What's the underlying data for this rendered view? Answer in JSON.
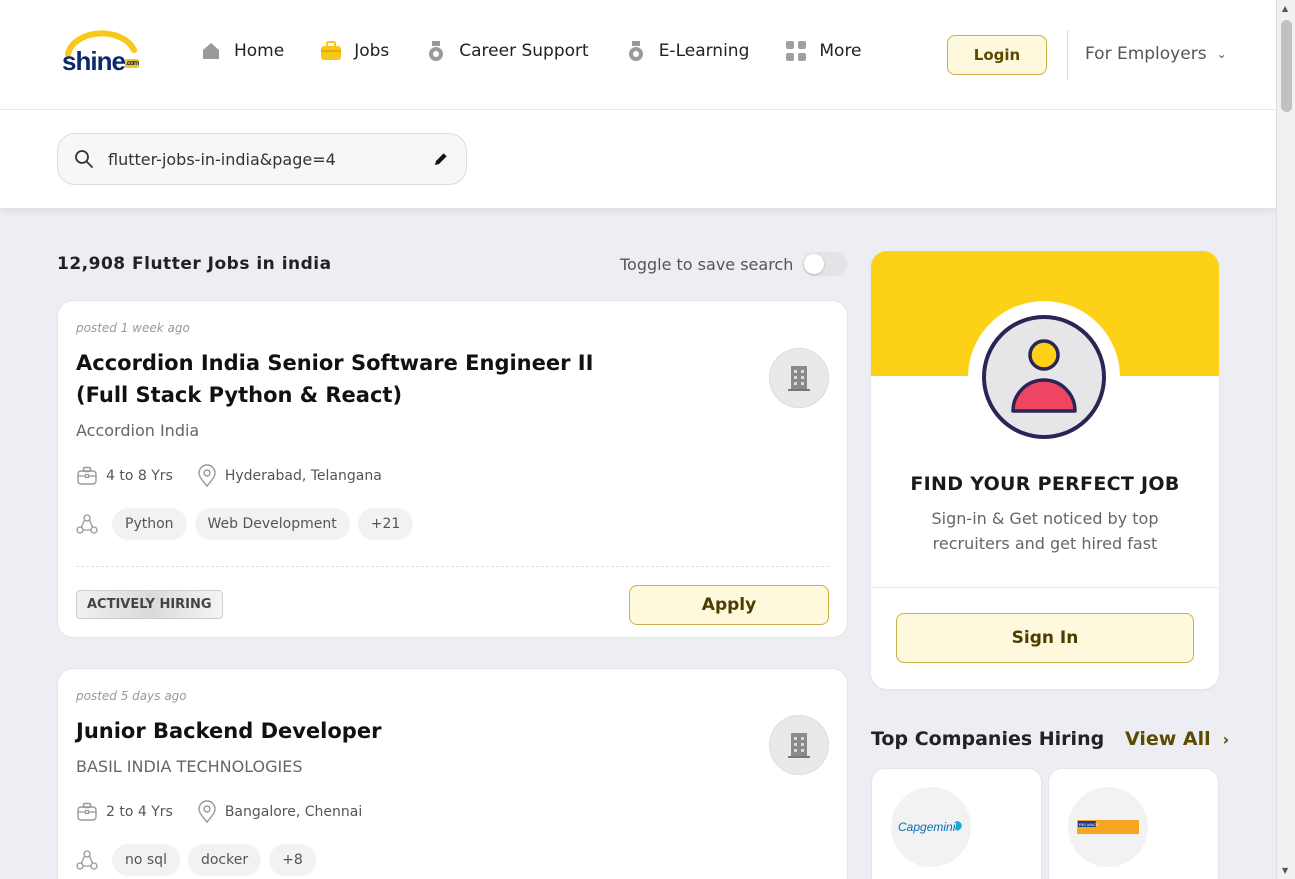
{
  "header": {
    "logo_text": "shine",
    "logo_com": ".com",
    "nav": [
      {
        "label": "Home",
        "icon": "home-icon"
      },
      {
        "label": "Jobs",
        "icon": "briefcase-icon"
      },
      {
        "label": "Career Support",
        "icon": "career-support-icon"
      },
      {
        "label": "E-Learning",
        "icon": "e-learning-icon"
      },
      {
        "label": "More",
        "icon": "grid-icon"
      }
    ],
    "login_label": "Login",
    "employers_label": "For Employers"
  },
  "search": {
    "value": "flutter-jobs-in-india&page=4"
  },
  "results": {
    "title": "12,908 Flutter Jobs in india",
    "toggle_label": "Toggle to save search",
    "save_search_enabled": false
  },
  "jobs": [
    {
      "posted": "posted 1 week ago",
      "title": "Accordion India Senior Software Engineer II (Full Stack Python & React)",
      "company": "Accordion India",
      "experience": "4 to 8 Yrs",
      "location": "Hyderabad, Telangana",
      "skills": [
        "Python",
        "Web Development",
        "+21"
      ],
      "badge": "ACTIVELY HIRING",
      "apply_label": "Apply"
    },
    {
      "posted": "posted 5 days ago",
      "title": "Junior Backend Developer",
      "company": "BASIL INDIA TECHNOLOGIES",
      "experience": "2 to 4 Yrs",
      "location": "Bangalore, Chennai",
      "skills": [
        "no sql",
        "docker",
        "+8"
      ]
    }
  ],
  "promo": {
    "title": "FIND YOUR PERFECT JOB",
    "subtitle": "Sign-in & Get noticed by top recruiters and get hired fast",
    "signin_label": "Sign In"
  },
  "top_companies": {
    "title": "Top Companies Hiring",
    "view_all": "View All",
    "companies": [
      {
        "logo_text": "Capgemini"
      },
      {
        "logo_text": "RELIANCE"
      }
    ]
  },
  "colors": {
    "brand_yellow": "#fcd116",
    "button_bg": "#fef8dc",
    "button_border": "#c9b04a",
    "logo_blue": "#0b2a6b"
  }
}
